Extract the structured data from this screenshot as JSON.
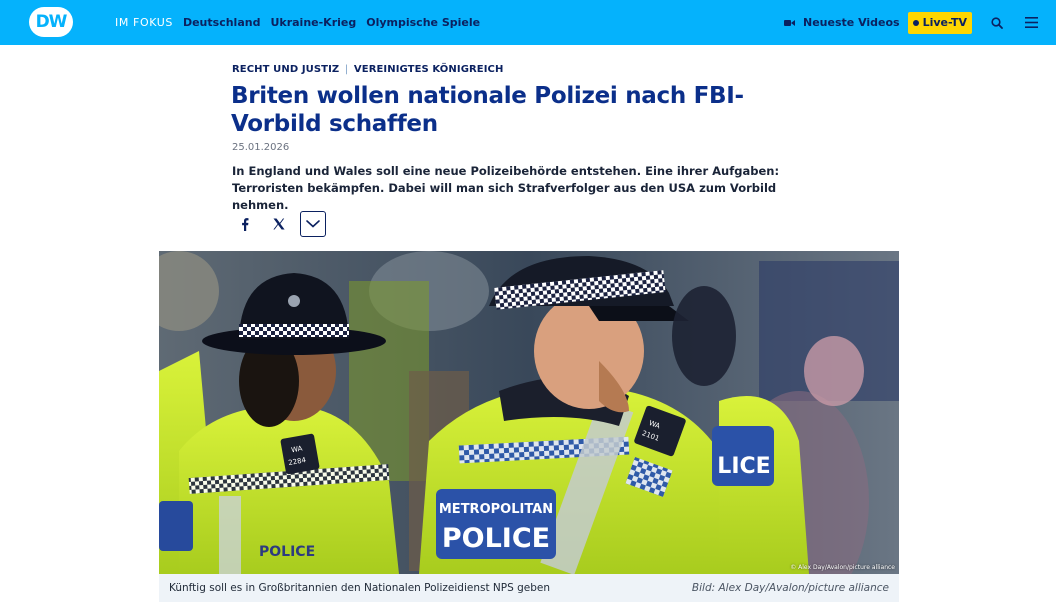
{
  "header": {
    "logo_text": "DW",
    "focus_label": "IM FOKUS",
    "nav_links": [
      "Deutschland",
      "Ukraine-Krieg",
      "Olympische Spiele"
    ],
    "videos_label": "Neueste Videos",
    "live_label": "Live-TV",
    "colors": {
      "bar": "#05b2fc",
      "live": "#ffd600",
      "text": "#0b2160"
    },
    "icons": [
      "video-camera-icon",
      "search-icon",
      "hamburger-menu-icon"
    ]
  },
  "article": {
    "kicker_part1": "RECHT UND JUSTIZ",
    "kicker_sep": "|",
    "kicker_part2": "VEREINIGTES KÖNIGREICH",
    "title": "Briten wollen nationale Polizei nach FBI-Vorbild schaffen",
    "date": "25.01.2026",
    "teaser": "In England und Wales soll eine neue Polizeibehörde entstehen. Eine ihrer Aufgaben: Terroristen bekämpfen. Dabei will man sich Strafverfolger aus den USA zum Vorbild nehmen.",
    "share_icons": [
      "facebook-icon",
      "x-icon",
      "chevron-down-icon"
    ]
  },
  "image": {
    "overlay_credit": "© Alex Day/Avalon/picture alliance",
    "caption": "Künftig soll es in Großbritannien den Nationalen Polizeidienst NPS geben",
    "credit": "Bild: Alex Day/Avalon/picture alliance",
    "vest_text_1": "METROPOLITAN",
    "vest_text_2": "POLICE",
    "vest_text_left": "POLICE",
    "vest_text_right": "LICE",
    "badge_left_1": "WA",
    "badge_left_2": "2284",
    "badge_right_1": "WA",
    "badge_right_2": "2101"
  }
}
